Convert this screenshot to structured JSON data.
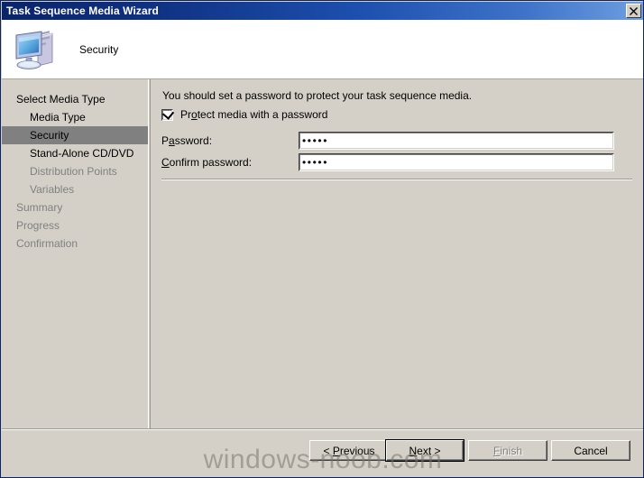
{
  "window": {
    "title": "Task Sequence Media Wizard",
    "close_label": "✕"
  },
  "header": {
    "icon": "computer-icon",
    "page_title": "Security"
  },
  "sidebar": {
    "items": [
      {
        "label": "Select Media Type",
        "indent": false,
        "state": "normal"
      },
      {
        "label": "Media Type",
        "indent": true,
        "state": "normal"
      },
      {
        "label": "Security",
        "indent": true,
        "state": "selected"
      },
      {
        "label": "Stand-Alone CD/DVD",
        "indent": true,
        "state": "normal"
      },
      {
        "label": "Distribution Points",
        "indent": true,
        "state": "dim"
      },
      {
        "label": "Variables",
        "indent": true,
        "state": "dim"
      },
      {
        "label": "Summary",
        "indent": false,
        "state": "dim"
      },
      {
        "label": "Progress",
        "indent": false,
        "state": "dim"
      },
      {
        "label": "Confirmation",
        "indent": false,
        "state": "dim"
      }
    ]
  },
  "content": {
    "intro_text": "You should set a password to protect your task sequence media.",
    "checkbox": {
      "label": "Protect media with a password",
      "accel": "o",
      "checked": true
    },
    "password_field": {
      "label": "Password:",
      "accel": "a",
      "value": "•••••",
      "char_count": 5
    },
    "confirm_field": {
      "label": "Confirm password:",
      "accel": "C",
      "value": "•••••",
      "char_count": 5
    }
  },
  "footer": {
    "previous": {
      "label": "< Previous",
      "accel": "P",
      "enabled": true,
      "default": false
    },
    "next": {
      "label": "Next >",
      "accel": "N",
      "enabled": true,
      "default": true
    },
    "finish": {
      "label": "Finish",
      "accel": "F",
      "enabled": false,
      "default": false
    },
    "cancel": {
      "label": "Cancel",
      "accel": "",
      "enabled": true,
      "default": false
    }
  },
  "watermark": {
    "text": "windows-noob.com"
  },
  "colors": {
    "titlebar_start": "#0a246a",
    "titlebar_end": "#6f9fe0",
    "dialog_face": "#d4d0c8",
    "selected_nav": "#808080",
    "disabled_text": "#808080",
    "field_background": "#ffffff"
  }
}
